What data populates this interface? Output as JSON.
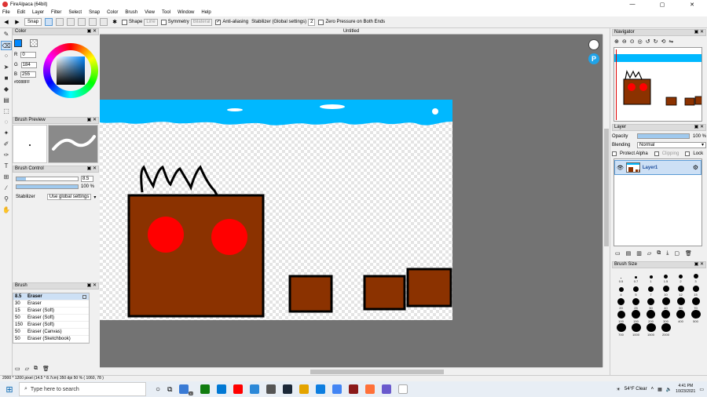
{
  "window": {
    "title": "FireAlpaca (64bit)",
    "controls": [
      "—",
      "▢",
      "✕"
    ]
  },
  "menu": [
    "File",
    "Edit",
    "Layer",
    "Filter",
    "Select",
    "Snap",
    "Color",
    "Brush",
    "View",
    "Tool",
    "Window",
    "Help"
  ],
  "toolbar": {
    "snap_label": "Snap",
    "shape_label": "Shape",
    "shape_value": "Line",
    "symmetry_label": "Symmetry",
    "symmetry_value": "Bilateral",
    "antialias_label": "Anti-aliasing",
    "stabilizer_label": "Stabilizer (Global settings)",
    "stabilizer_value": "2",
    "zero_pressure_label": "Zero Pressure on Both Ends"
  },
  "panels": {
    "color": {
      "title": "Color",
      "r": "0",
      "g": "184",
      "b": "255",
      "hex": "#0088FF",
      "fg_color": "#0088ff"
    },
    "brush_preview": {
      "title": "Brush Preview"
    },
    "brush_control": {
      "title": "Brush Control",
      "size": "8.5",
      "opacity": "100 %",
      "stabilizer_label": "Stabilizer",
      "stabilizer_value": "Use global settings"
    },
    "brush": {
      "title": "Brush",
      "items": [
        {
          "size": "8.5",
          "name": "Eraser"
        },
        {
          "size": "30",
          "name": "Eraser"
        },
        {
          "size": "15",
          "name": "Eraser (Soft)"
        },
        {
          "size": "50",
          "name": "Eraser (Soft)"
        },
        {
          "size": "150",
          "name": "Eraser (Soft)"
        },
        {
          "size": "50",
          "name": "Eraser (Canvas)"
        },
        {
          "size": "50",
          "name": "Eraser (Sketchbook)"
        }
      ]
    }
  },
  "document": {
    "tab": "Untitled"
  },
  "navigator": {
    "title": "Navigator"
  },
  "layer": {
    "title": "Layer",
    "opacity_label": "Opacity",
    "opacity_value": "100 %",
    "blending_label": "Blending",
    "blending_value": "Normal",
    "protect_alpha": "Protect Alpha",
    "clipping": "Clipping",
    "lock": "Lock",
    "layer_name": "Layer1"
  },
  "brush_size": {
    "title": "Brush Size",
    "sizes": [
      "0.5",
      "0.7",
      "1",
      "1.5",
      "2",
      "3",
      "4",
      "5",
      "7",
      "10",
      "12",
      "15",
      "20",
      "25",
      "30",
      "40",
      "50",
      "70",
      "100",
      "150",
      "200",
      "300",
      "400",
      "500",
      "700",
      "1000",
      "1500",
      "2000"
    ]
  },
  "status": {
    "text": "2000 * 1200 pixel   (14.5 * 8.7cm)  350 dpi   50 %   ( 1060, 78 )"
  },
  "taskbar": {
    "search_placeholder": "Type here to search",
    "badge": "32",
    "weather": "54°F  Clear",
    "time": "4:41 PM",
    "date": "10/23/2021"
  }
}
